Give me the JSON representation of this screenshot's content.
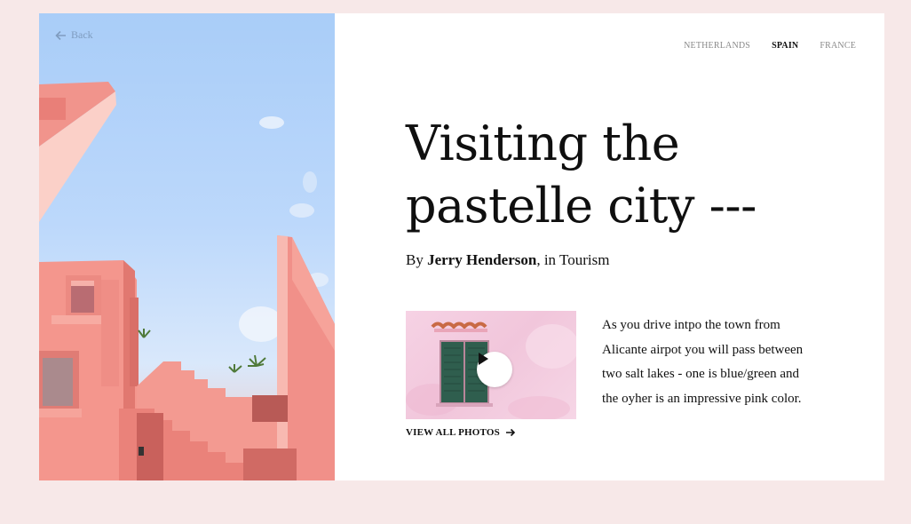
{
  "back": {
    "label": "Back",
    "icon": "arrow-left-icon"
  },
  "nav": {
    "items": [
      {
        "label": "NETHERLANDS",
        "active": false
      },
      {
        "label": "SPAIN",
        "active": true
      },
      {
        "label": "FRANCE",
        "active": false
      }
    ]
  },
  "article": {
    "title_line1": "Visiting the",
    "title_line2": "pastelle city ---",
    "by_prefix": "By",
    "author": "Jerry Henderson",
    "category_text": ", in Tourism",
    "excerpt": "As you drive intpo the town from Alicante airpot you will pass between two salt lakes - one is blue/green and the oyher is an impressive pink color."
  },
  "media": {
    "play_icon": "play-icon",
    "view_all_label": "VIEW ALL PHOTOS",
    "view_all_icon": "arrow-right-icon"
  },
  "colors": {
    "page_bg": "#f7e8e8",
    "card_bg": "#ffffff",
    "sky": "#a9cdf8",
    "building_pink": "#f08a82",
    "shutter_green": "#2f5e4e"
  }
}
